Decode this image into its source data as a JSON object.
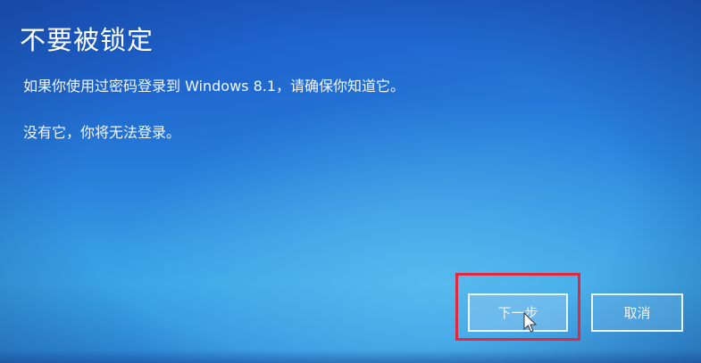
{
  "dialog": {
    "title": "不要被锁定",
    "message_line1": "如果你使用过密码登录到 Windows 8.1，请确保你知道它。",
    "message_line2": "没有它，你将无法登录。"
  },
  "buttons": {
    "next_label": "下一步",
    "cancel_label": "取消"
  },
  "colors": {
    "background": "#2a86dd",
    "text": "#ffffff",
    "highlight_box": "#e3283c"
  },
  "icons": {
    "cursor": "mouse-pointer-icon"
  }
}
